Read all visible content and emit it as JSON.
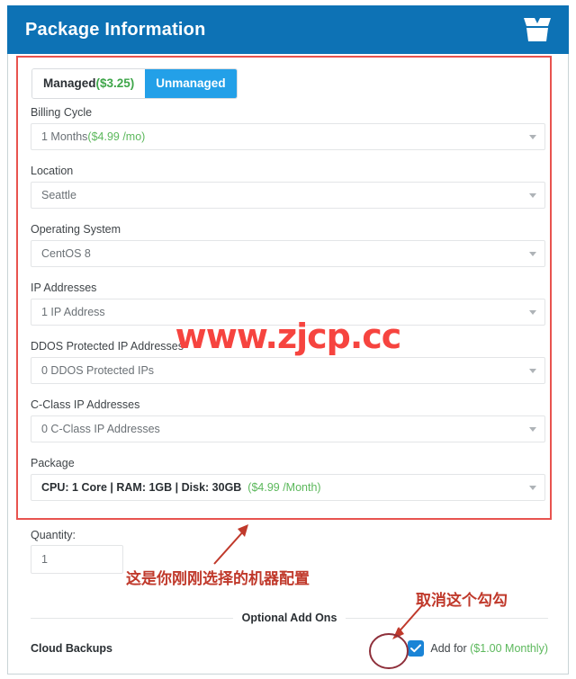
{
  "header": {
    "title": "Package Information",
    "icon": "open-box-icon",
    "bg_color": "#0d72b5"
  },
  "tabs": [
    {
      "label": "Managed",
      "price": "($3.25)",
      "active": false
    },
    {
      "label": "Unmanaged",
      "price": "",
      "active": true
    }
  ],
  "fields": [
    {
      "label": "Billing Cycle",
      "value": "1 Months ",
      "value_extra": "($4.99 /mo)",
      "extra_style": "green"
    },
    {
      "label": "Location",
      "value": "Seattle",
      "value_extra": "",
      "extra_style": "none"
    },
    {
      "label": "Operating System",
      "value": "CentOS 8",
      "value_extra": "",
      "extra_style": "none"
    },
    {
      "label": "IP Addresses",
      "value": "1 IP Address",
      "value_extra": "",
      "extra_style": "none"
    },
    {
      "label": "DDOS Protected IP Addresses",
      "value": "0 DDOS Protected IPs",
      "value_extra": "",
      "extra_style": "none"
    },
    {
      "label": "C-Class IP Addresses",
      "value": "0 C-Class IP Addresses",
      "value_extra": "",
      "extra_style": "none"
    },
    {
      "label": "Package",
      "value": "CPU: 1 Core | RAM: 1GB | Disk: 30GB",
      "value_extra": "($4.99 /Month)",
      "extra_style": "green"
    }
  ],
  "quantity": {
    "label": "Quantity:",
    "value": "1"
  },
  "addons": {
    "divider_label": "Optional Add Ons",
    "items": [
      {
        "name": "Cloud Backups",
        "checked": true,
        "add_label": "Add for ",
        "price": "($1.00 Monthly)"
      }
    ]
  },
  "watermark": {
    "text": "www.zjcp.cc",
    "color": "#f6443f"
  },
  "annotations": {
    "highlight_box_color": "#e8534f",
    "note_package": "这是你刚刚选择的机器配置",
    "note_checkbox": "取消这个勾勾",
    "circle_color": "#8e2f3a"
  }
}
